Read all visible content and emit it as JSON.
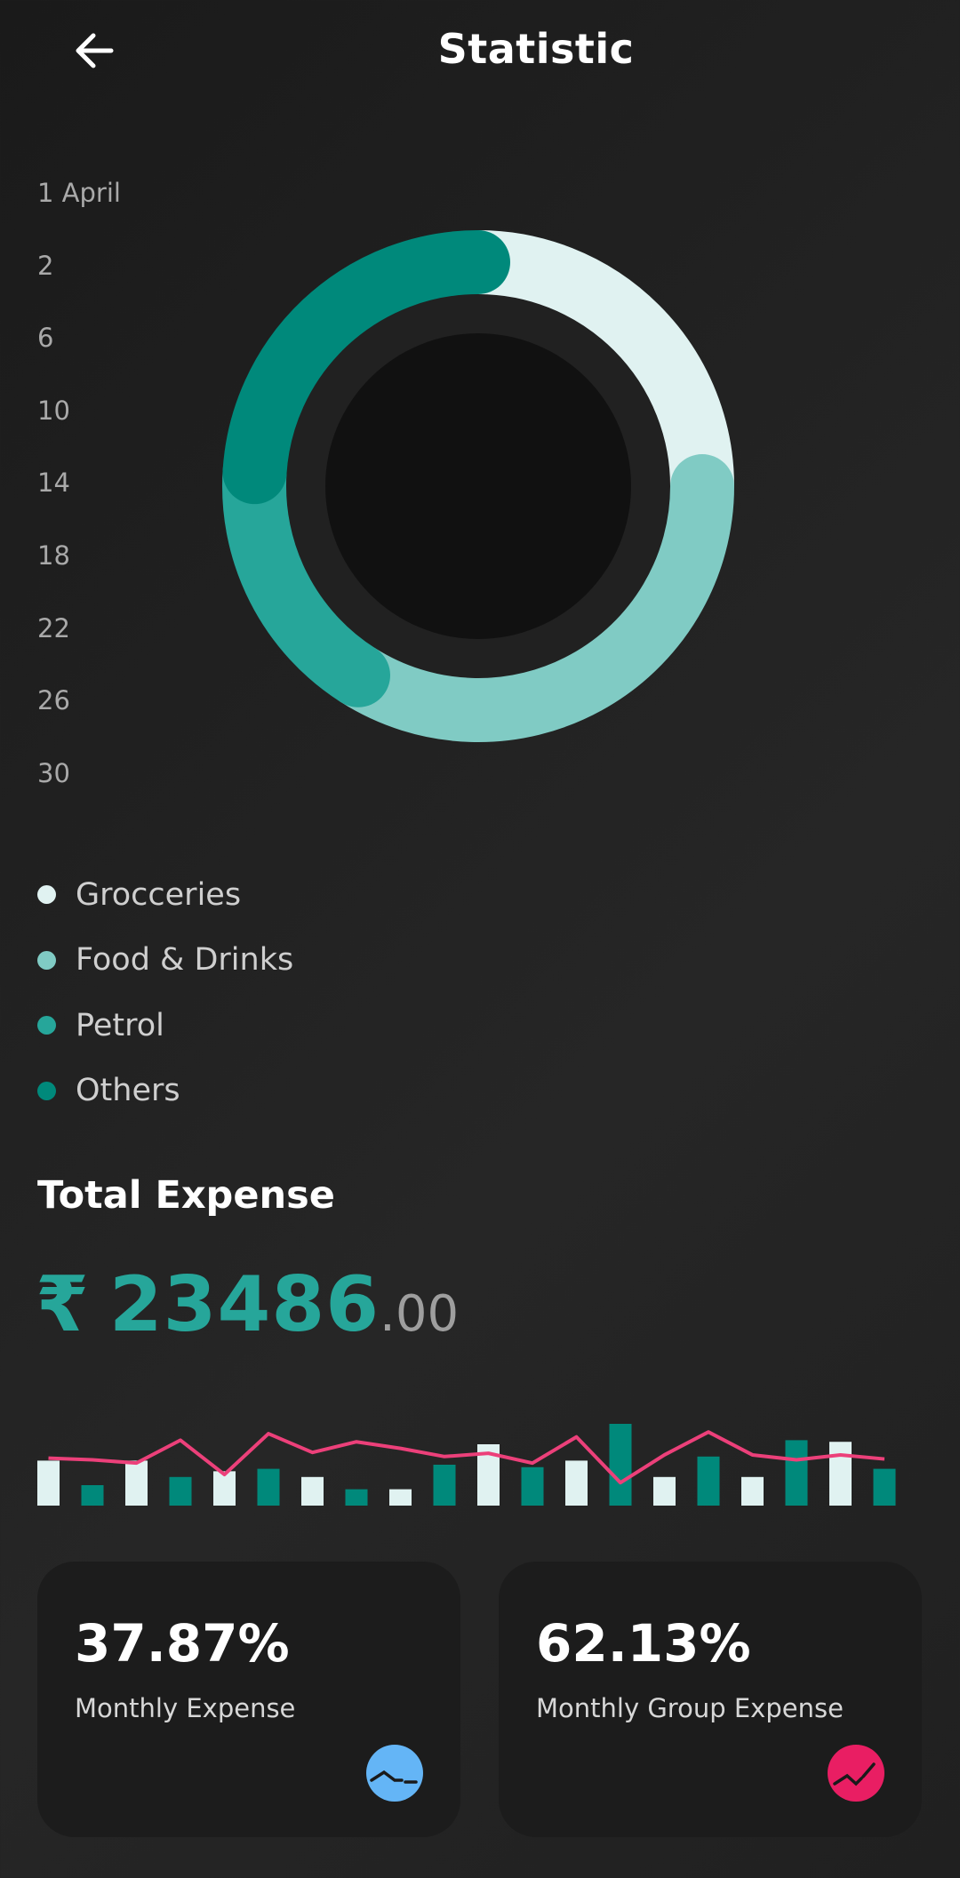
{
  "header": {
    "title": "Statistic",
    "back_icon": "arrow-left-icon"
  },
  "date_axis": {
    "labels": [
      "1 April",
      "2",
      "6",
      "10",
      "14",
      "18",
      "22",
      "26",
      "30"
    ]
  },
  "colors": {
    "groceries": "#e0f2f1",
    "food_drinks": "#80cbc4",
    "petrol": "#26a69a",
    "others": "#00897b",
    "accent": "#26a69a",
    "line": "#ec407a",
    "card_left_icon_bg": "#64b5f6",
    "card_right_icon_bg": "#e91e63"
  },
  "legend": {
    "items": [
      {
        "label": "Grocceries",
        "color": "#e0f2f1"
      },
      {
        "label": "Food & Drinks",
        "color": "#80cbc4"
      },
      {
        "label": "Petrol",
        "color": "#26a69a"
      },
      {
        "label": "Others",
        "color": "#00897b"
      }
    ]
  },
  "chart_data": {
    "type": "pie",
    "categories": [
      "Grocceries",
      "Food & Drinks",
      "Petrol",
      "Others"
    ],
    "values": [
      25,
      34,
      17,
      24
    ]
  },
  "summary": {
    "title": "Total Expense",
    "currency": "₹",
    "amount_whole": "23486",
    "amount_decimals": ".00"
  },
  "trend": {
    "bars": [
      {
        "level": 0.55,
        "color": "#e0f2f1"
      },
      {
        "level": 0.25,
        "color": "#00897b"
      },
      {
        "level": 0.55,
        "color": "#e0f2f1"
      },
      {
        "level": 0.35,
        "color": "#00897b"
      },
      {
        "level": 0.42,
        "color": "#e0f2f1"
      },
      {
        "level": 0.45,
        "color": "#00897b"
      },
      {
        "level": 0.35,
        "color": "#e0f2f1"
      },
      {
        "level": 0.2,
        "color": "#00897b"
      },
      {
        "level": 0.2,
        "color": "#e0f2f1"
      },
      {
        "level": 0.5,
        "color": "#00897b"
      },
      {
        "level": 0.75,
        "color": "#e0f2f1"
      },
      {
        "level": 0.47,
        "color": "#00897b"
      },
      {
        "level": 0.55,
        "color": "#e0f2f1"
      },
      {
        "level": 1.0,
        "color": "#00897b"
      },
      {
        "level": 0.35,
        "color": "#e0f2f1"
      },
      {
        "level": 0.6,
        "color": "#00897b"
      },
      {
        "level": 0.35,
        "color": "#e0f2f1"
      },
      {
        "level": 0.8,
        "color": "#00897b"
      },
      {
        "level": 0.78,
        "color": "#e0f2f1"
      },
      {
        "level": 0.45,
        "color": "#00897b"
      }
    ],
    "line": [
      0.58,
      0.56,
      0.52,
      0.8,
      0.38,
      0.88,
      0.65,
      0.78,
      0.7,
      0.6,
      0.64,
      0.52,
      0.84,
      0.28,
      0.62,
      0.9,
      0.62,
      0.56,
      0.62,
      0.57
    ]
  },
  "cards": [
    {
      "value": "37.87%",
      "label": "Monthly Expense",
      "icon": "trend-down-icon",
      "icon_color": "#64b5f6"
    },
    {
      "value": "62.13%",
      "label": "Monthly Group Expense",
      "icon": "trend-up-icon",
      "icon_color": "#e91e63"
    }
  ]
}
